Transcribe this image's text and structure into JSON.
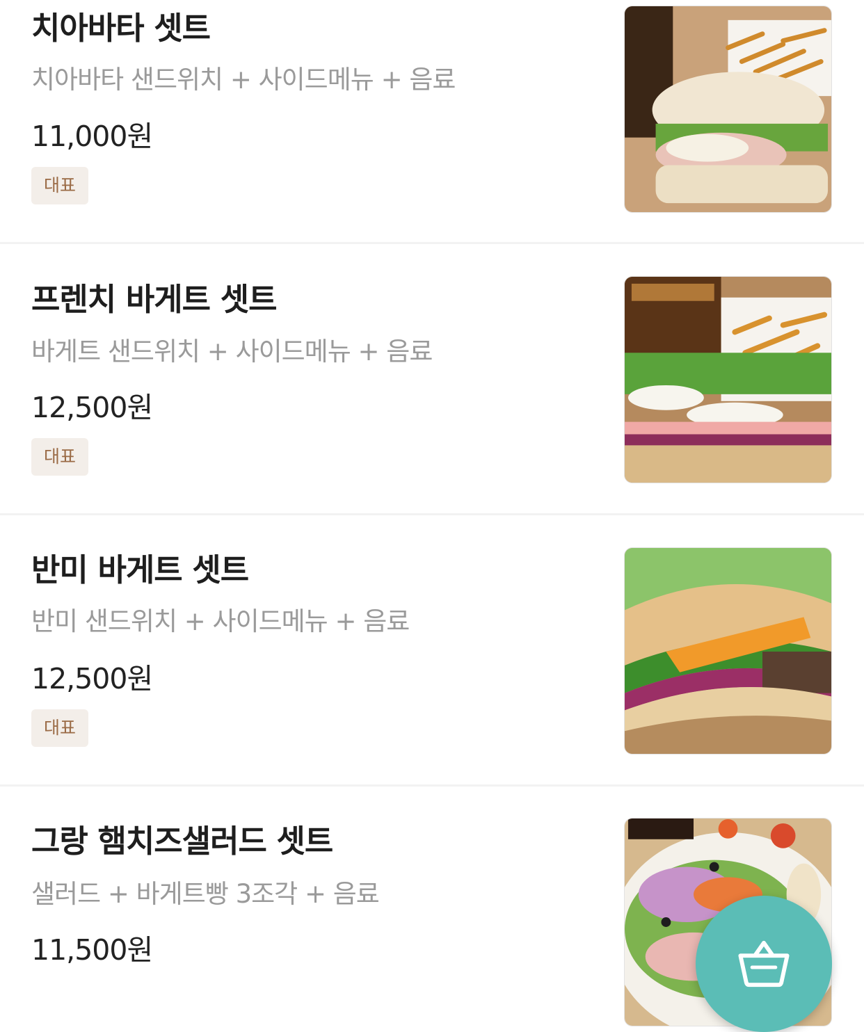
{
  "menu": {
    "items": [
      {
        "name": "치아바타 셋트",
        "description": "치아바타 샌드위치 + 사이드메뉴 + 음료",
        "price": "11,000원",
        "badge": "대표",
        "image_icon": "ciabatta-sandwich-photo"
      },
      {
        "name": "프렌치 바게트 셋트",
        "description": "바게트 샌드위치 + 사이드메뉴 + 음료",
        "price": "12,500원",
        "badge": "대표",
        "image_icon": "baguette-sandwich-photo"
      },
      {
        "name": "반미 바게트 셋트",
        "description": "반미 샌드위치 + 사이드메뉴 + 음료",
        "price": "12,500원",
        "badge": "대표",
        "image_icon": "banh-mi-photo"
      },
      {
        "name": "그랑 햄치즈샐러드 셋트",
        "description": "샐러드 + 바게트빵 3조각 + 음료",
        "price": "11,500원",
        "image_icon": "ham-cheese-salad-photo"
      }
    ]
  },
  "cart_button": {
    "icon": "shopping-basket-icon"
  },
  "colors": {
    "badge_background": "#f3eee9",
    "badge_text": "#9a6a45",
    "cart_button": "#5bbdb6",
    "description_text": "#9a9a9a"
  }
}
